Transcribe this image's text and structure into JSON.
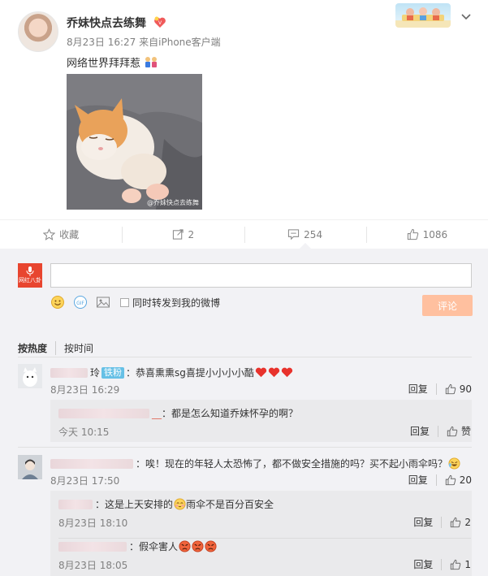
{
  "post": {
    "author": "乔妹快点去练舞",
    "date": "8月23日 16:27",
    "source_prefix": "来自",
    "source": "iPhone客户端",
    "text": "网络世界拜拜惹",
    "photo_watermark": "@乔妹快点去练舞"
  },
  "actions": {
    "favorite_label": "收藏",
    "forward_count": "2",
    "comment_count": "254",
    "like_count": "1086"
  },
  "compose": {
    "avatar_caption": "网红八卦",
    "input_placeholder": "",
    "repost_label": "同时转发到我的微博",
    "submit_label": "评论"
  },
  "sort": {
    "hot_label": "按热度",
    "time_label": "按时间"
  },
  "comments": [
    {
      "name_tail": "玲",
      "badge": "铁粉",
      "text": "：恭喜熏熏sg喜提小小小小酷",
      "time": "8月23日 16:29",
      "reply_label": "回复",
      "likes": "90",
      "replies": [
        {
          "name_tail": "__",
          "text": "：都是怎么知道乔妹怀孕的啊？",
          "time": "今天 10:15",
          "reply_label": "回复",
          "likes": "赞"
        }
      ]
    },
    {
      "name_tail": "",
      "badge": "",
      "text": "：唉！现在的年轻人太恐怖了，都不做安全措施的吗？买不起小雨伞吗？",
      "time": "8月23日 17:50",
      "reply_label": "回复",
      "likes": "20",
      "replies": [
        {
          "name_tail": "",
          "text": "：这是上天安排的",
          "text_after": "雨伞不是百分百安全",
          "time": "8月23日 18:10",
          "reply_label": "回复",
          "likes": "2"
        },
        {
          "name_tail": "",
          "text": "：假伞害人",
          "time": "8月23日 18:05",
          "reply_label": "回复",
          "likes": "1"
        }
      ]
    }
  ],
  "colors": {
    "submit_bg": "#ffc09f",
    "badge_bg": "#66c0e6",
    "brand_red": "#e8452f",
    "comments_bg": "#f2f2f5"
  }
}
